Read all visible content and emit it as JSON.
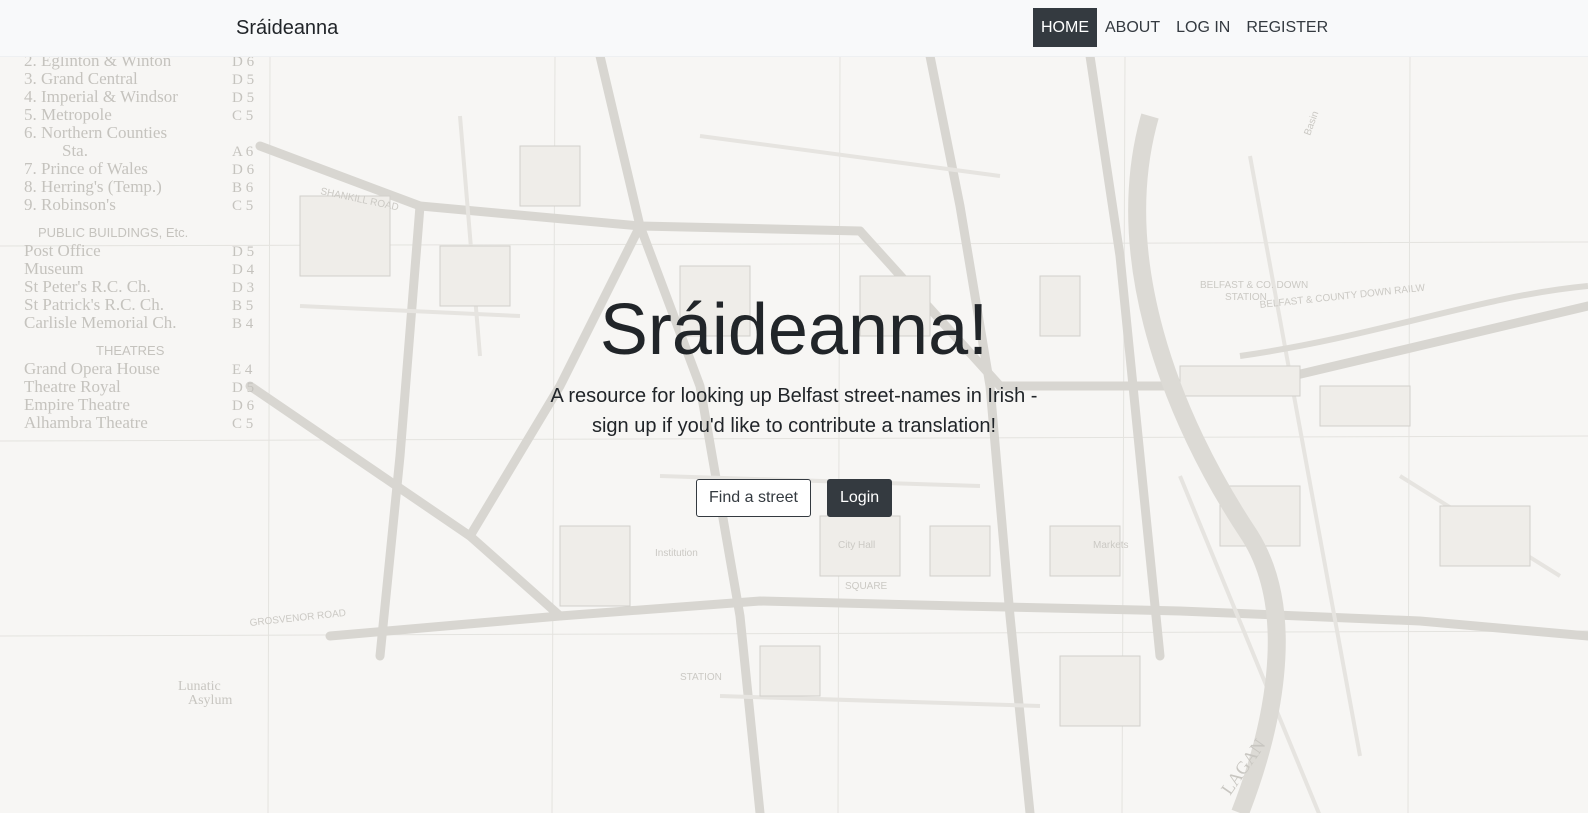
{
  "navbar": {
    "brand": "Sráideanna",
    "links": [
      {
        "label": "HOME",
        "active": true
      },
      {
        "label": "ABOUT",
        "active": false
      },
      {
        "label": "LOG IN",
        "active": false
      },
      {
        "label": "REGISTER",
        "active": false
      }
    ]
  },
  "hero": {
    "title": "Sráideanna!",
    "lead": "A resource for looking up Belfast street-names in Irish - sign up if you'd like to contribute a translation!",
    "buttons": {
      "find_street": "Find a street",
      "login": "Login"
    }
  },
  "map_legend": {
    "hotels": [
      "2. Eglinton & Winton",
      "3. Grand Central",
      "4. Imperial & Windsor",
      "5. Metropole",
      "6. Northern Counties",
      "Sta.",
      "7. Prince of Wales",
      "8. Herring's (Temp.)",
      "9. Robinson's"
    ],
    "hotel_refs": [
      "D 6",
      "D 5",
      "D 5",
      "C 5",
      "",
      "A 6",
      "D 6",
      "B 6",
      "C 5"
    ],
    "public_buildings_heading": "PUBLIC BUILDINGS, Etc.",
    "public_buildings": [
      "Post Office",
      "Museum",
      "St Peter's R.C. Ch.",
      "St Patrick's R.C. Ch.",
      "Carlisle Memorial Ch."
    ],
    "public_buildings_refs": [
      "D 5",
      "D 4",
      "D 3",
      "B 5",
      "B 4"
    ],
    "theatres_heading": "THEATRES",
    "theatres": [
      "Grand Opera House",
      "Theatre Royal",
      "Empire Theatre",
      "Alhambra Theatre"
    ],
    "theatres_refs": [
      "E 4",
      "D 5",
      "D 6",
      "C 5"
    ]
  },
  "map_labels": {
    "shankill": "SHANKILL ROAD",
    "grosvenor": "GROSVENOR ROAD",
    "lunatic": "Lunatic",
    "asylum": "Asylum",
    "lagan": "LAGAN",
    "station1": "BELFAST & CO. DOWN",
    "station2": "STATION",
    "county_down": "BELFAST & COUNTY DOWN RAILW",
    "city_hall": "City Hall",
    "square": "SQUARE",
    "markets": "Markets",
    "institution": "Institution",
    "basin": "Basin",
    "gnr_station": "STATION"
  },
  "colors": {
    "navbar_bg": "#f8f9fa",
    "dark": "#343a40",
    "text": "#212529",
    "map_ink": "#cfcdc8",
    "map_paper": "#f7f6f4"
  }
}
